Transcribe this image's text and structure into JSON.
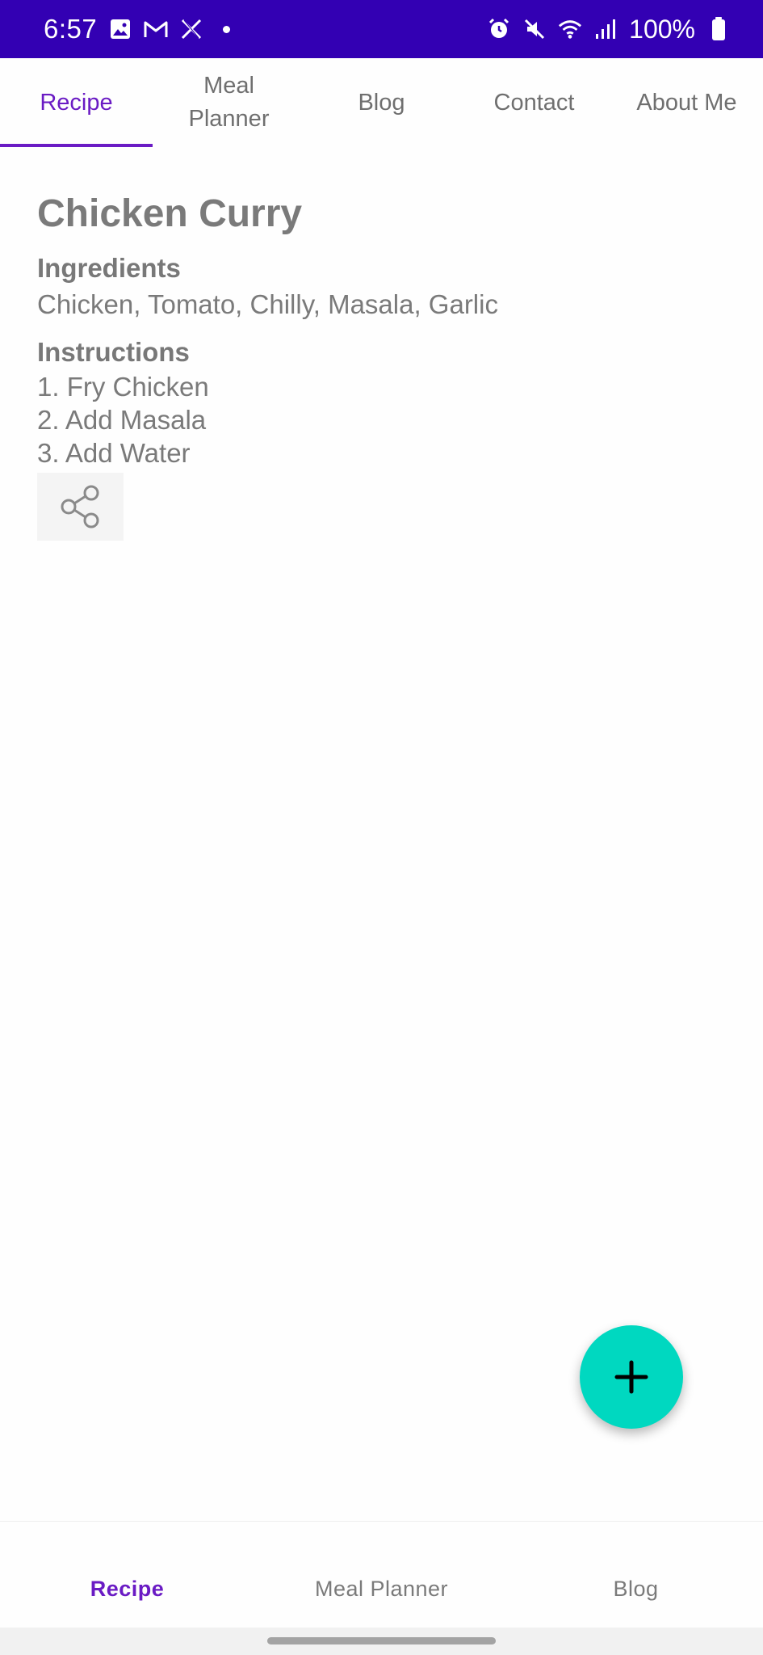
{
  "status_bar": {
    "time": "6:57",
    "battery": "100%",
    "left_icons": [
      "gallery-icon",
      "gmail-icon",
      "x-icon",
      "notification-dot"
    ],
    "right_icons": [
      "alarm-icon",
      "mute-icon",
      "wifi-icon",
      "signal-icon",
      "battery-icon"
    ],
    "color": "#3300b3"
  },
  "top_tabs": [
    {
      "label": "Recipe",
      "active": true
    },
    {
      "label": "Meal\nPlanner",
      "active": false
    },
    {
      "label": "Blog",
      "active": false
    },
    {
      "label": "Contact",
      "active": false
    },
    {
      "label": "About Me",
      "active": false
    }
  ],
  "recipe": {
    "title": "Chicken Curry",
    "ingredients_heading": "Ingredients",
    "ingredients": "Chicken, Tomato, Chilly, Masala, Garlic",
    "instructions_heading": "Instructions",
    "instructions": [
      "1. Fry Chicken",
      "2. Add Masala",
      "3. Add Water"
    ],
    "share_icon": "share-icon"
  },
  "fab": {
    "icon": "plus-icon",
    "color": "#00d8c0"
  },
  "bottom_nav": [
    {
      "label": "Recipe",
      "active": true
    },
    {
      "label": "Meal Planner",
      "active": false
    },
    {
      "label": "Blog",
      "active": false
    }
  ],
  "accent_color": "#6a1bc4"
}
